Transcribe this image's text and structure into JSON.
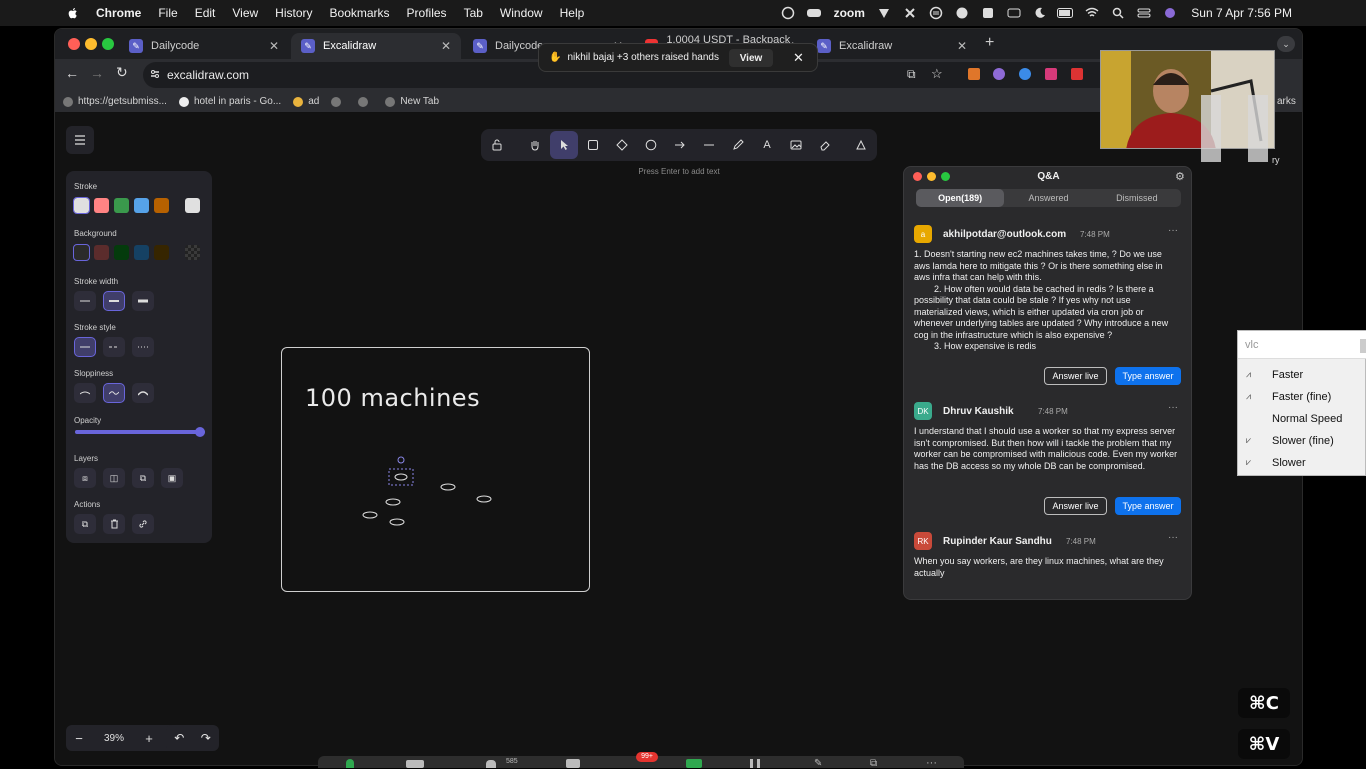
{
  "menubar": {
    "app": "Chrome",
    "items": [
      "File",
      "Edit",
      "View",
      "History",
      "Bookmarks",
      "Profiles",
      "Tab",
      "Window",
      "Help"
    ],
    "zoom_label": "zoom",
    "clock": "Sun 7 Apr  7:56 PM"
  },
  "browser": {
    "tabs": [
      {
        "title": "Dailycode"
      },
      {
        "title": "Excalidraw"
      },
      {
        "title": "Dailycode"
      },
      {
        "title": "1.0004 USDT - Backpack Exc"
      },
      {
        "title": "Excalidraw"
      }
    ],
    "url": "excalidraw.com",
    "bookmarks": [
      "https://getsubmiss...",
      "hotel in paris - Go...",
      "ad",
      "",
      "",
      "New Tab"
    ],
    "bookmarks_right": "arks"
  },
  "banner": {
    "text": "nikhil bajaj +3 others raised hands",
    "view_label": "View"
  },
  "excalidraw": {
    "hint": "Press Enter to add text",
    "frame_title": "100 machines",
    "zoom_level": "39%",
    "library_partial": "ry",
    "props": {
      "stroke": "Stroke",
      "background": "Background",
      "stroke_width": "Stroke width",
      "stroke_style": "Stroke style",
      "sloppiness": "Sloppiness",
      "opacity": "Opacity",
      "layers": "Layers",
      "actions": "Actions",
      "opacity_value": 1.0
    },
    "stroke_colors": [
      "#e0e0e0",
      "#ff8383",
      "#3a994c",
      "#56a2e8",
      "#b76100"
    ],
    "background_colors": [
      "#2b2b2b",
      "#5b2c2c",
      "#043b0c",
      "#154163",
      "#362500"
    ]
  },
  "qa": {
    "title": "Q&A",
    "tabs": [
      "Open(189)",
      "Answered",
      "Dismissed"
    ],
    "questions": [
      {
        "avatar": "a",
        "name": "akhilpotdar@outlook.com",
        "time": "7:48 PM",
        "body": "1. Doesn't starting new ec2 machines takes time, ? Do we use aws lamda here to mitigate this ? Or is there something else in aws infra that can help with this.\n        2. How often would data be cached in redis ? Is there a possibility that data could be stale ? If yes why not use materialized views, which is either updated via cron job or whenever underlying tables are updated ? Why introduce a new cog in the infrastructure which is also expensive ?\n        3. How expensive is redis"
      },
      {
        "avatar": "DK",
        "name": "Dhruv Kaushik",
        "time": "7:48 PM",
        "body": "I understand that I should use a worker so that my express server isn't compromised. But then how will i tackle the problem that my worker can be compromised with malicious code. Even my worker has the DB access so my whole DB can be compromised."
      },
      {
        "avatar": "RK",
        "name": "Rupinder Kaur Sandhu",
        "time": "7:48 PM",
        "body": "When you say workers, are they linux machines, what are they actually"
      }
    ],
    "answer_live": "Answer live",
    "type_answer": "Type answer"
  },
  "vlc": {
    "search": "vlc",
    "items": [
      "Faster",
      "Faster (fine)",
      "Normal Speed",
      "Slower (fine)",
      "Slower"
    ]
  },
  "keys": {
    "copy": "⌘C",
    "paste": "⌘V"
  },
  "dock": {
    "participants": "585",
    "chat_badge": "99+"
  },
  "colors": {
    "accent": "#6965db",
    "zoom_blue": "#0e72ed"
  }
}
